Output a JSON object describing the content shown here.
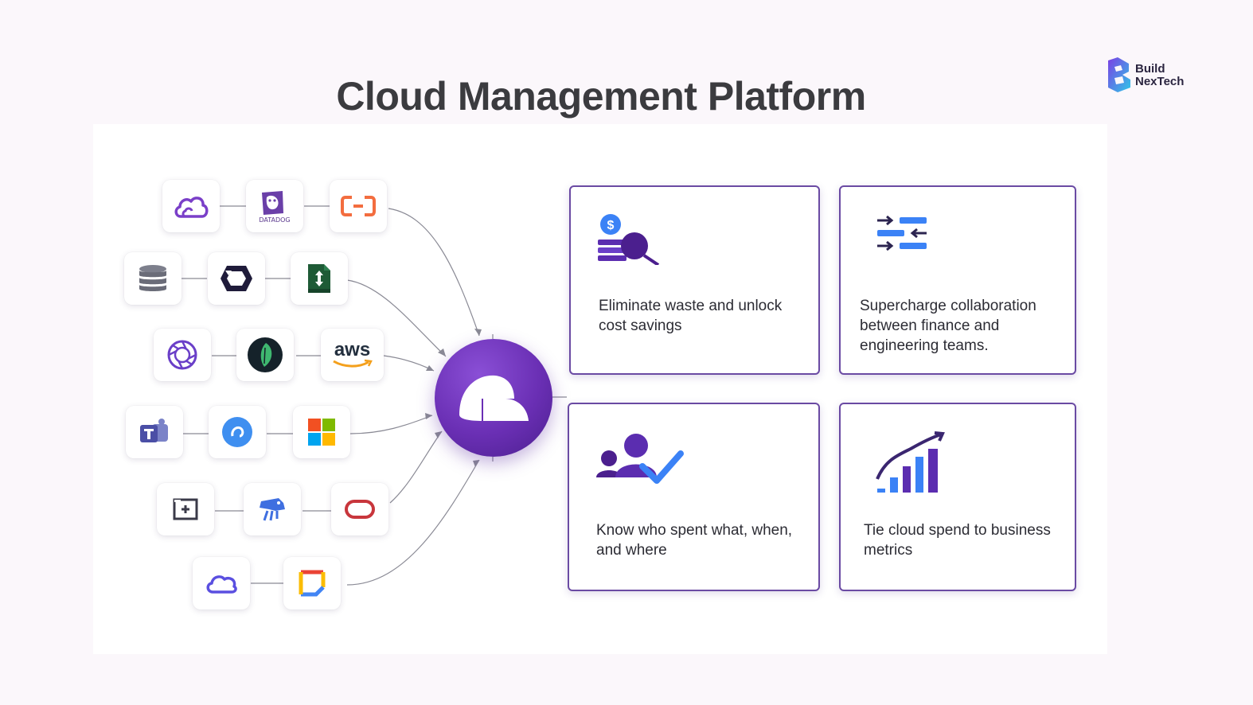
{
  "title": "Cloud Management Platform",
  "brand": {
    "line1": "Build",
    "line2": "NexTech"
  },
  "integrations": [
    {
      "row": 1,
      "items": [
        "cloud-icon",
        "datadog-icon",
        "alibaba-cloud-icon"
      ]
    },
    {
      "row": 2,
      "items": [
        "database-icon",
        "hexagon-logo-icon",
        "spreadsheet-icon"
      ]
    },
    {
      "row": 3,
      "items": [
        "aperture-icon",
        "leaf-icon",
        "aws-icon"
      ]
    },
    {
      "row": 4,
      "items": [
        "teams-icon",
        "blue-circle-icon",
        "microsoft-icon"
      ]
    },
    {
      "row": 5,
      "items": [
        "screen-icon",
        "drone-icon",
        "oracle-icon"
      ]
    },
    {
      "row": 6,
      "items": [
        "outline-cloud-icon",
        "google-square-icon"
      ]
    }
  ],
  "tile_labels": {
    "datadog": "DATADOG",
    "aws": "aws"
  },
  "hub": {
    "icon": "platform-hub-icon",
    "color": "#6a2fb4"
  },
  "cards": [
    {
      "icon": "cost-savings-icon",
      "text": "Eliminate waste and unlock cost savings"
    },
    {
      "icon": "collaboration-icon",
      "text": "Supercharge collaboration between finance and engineering teams."
    },
    {
      "icon": "users-check-icon",
      "text": "Know who spent what, when, and where"
    },
    {
      "icon": "growth-chart-icon",
      "text": "Tie cloud spend to business metrics"
    }
  ],
  "colors": {
    "accent": "#5b2db0",
    "card_border": "#6a4aa3",
    "blue": "#3b82f6",
    "title": "#3b3b3f"
  }
}
